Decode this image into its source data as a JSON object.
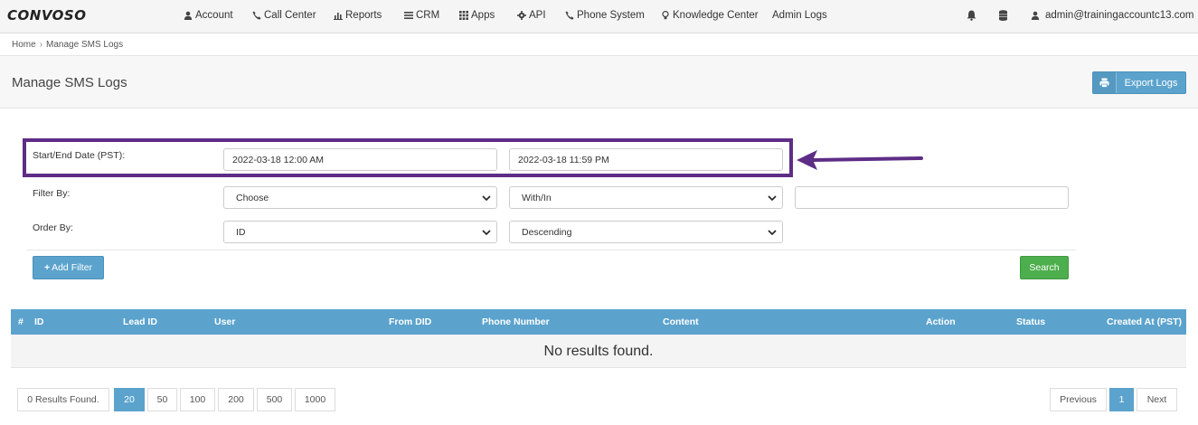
{
  "nav": {
    "logo": "CONVOSO",
    "items": [
      {
        "label": "Account",
        "icon": "user-icon"
      },
      {
        "label": "Call Center",
        "icon": "phone-icon"
      },
      {
        "label": "Reports",
        "icon": "bar-chart-icon"
      },
      {
        "label": "CRM",
        "icon": "list-icon"
      },
      {
        "label": "Apps",
        "icon": "grid-icon"
      },
      {
        "label": "API",
        "icon": "gear-icon"
      },
      {
        "label": "Phone System",
        "icon": "phone-icon"
      },
      {
        "label": "Knowledge Center",
        "icon": "lightbulb-icon"
      },
      {
        "label": "Admin Logs",
        "icon": ""
      }
    ],
    "user_email": "admin@trainingaccountc13.com"
  },
  "breadcrumb": {
    "home": "Home",
    "separator": "›",
    "current": "Manage SMS Logs"
  },
  "page": {
    "title": "Manage SMS Logs",
    "export_label": "Export Logs"
  },
  "form": {
    "date_label": "Start/End Date (PST):",
    "start_date": "2022-03-18 12:00 AM",
    "end_date": "2022-03-18 11:59 PM",
    "filter_label": "Filter By:",
    "filter_field": "Choose",
    "filter_operator": "With/In",
    "filter_value": "",
    "order_label": "Order By:",
    "order_field": "ID",
    "order_direction": "Descending",
    "add_filter_label": "Add Filter",
    "search_label": "Search"
  },
  "table": {
    "columns": [
      "#",
      "ID",
      "Lead ID",
      "User",
      "From DID",
      "Phone Number",
      "Content",
      "Action",
      "Status",
      "Created At (PST)"
    ],
    "empty_text": "No results found."
  },
  "pagination": {
    "results_text": "0 Results Found.",
    "page_sizes": [
      "20",
      "50",
      "100",
      "200",
      "500",
      "1000"
    ],
    "active_page_size": "20",
    "previous": "Previous",
    "current_page": "1",
    "next": "Next"
  },
  "colors": {
    "primary": "#5ba3cd",
    "success": "#4cae4c",
    "highlight": "#5e2d86"
  }
}
